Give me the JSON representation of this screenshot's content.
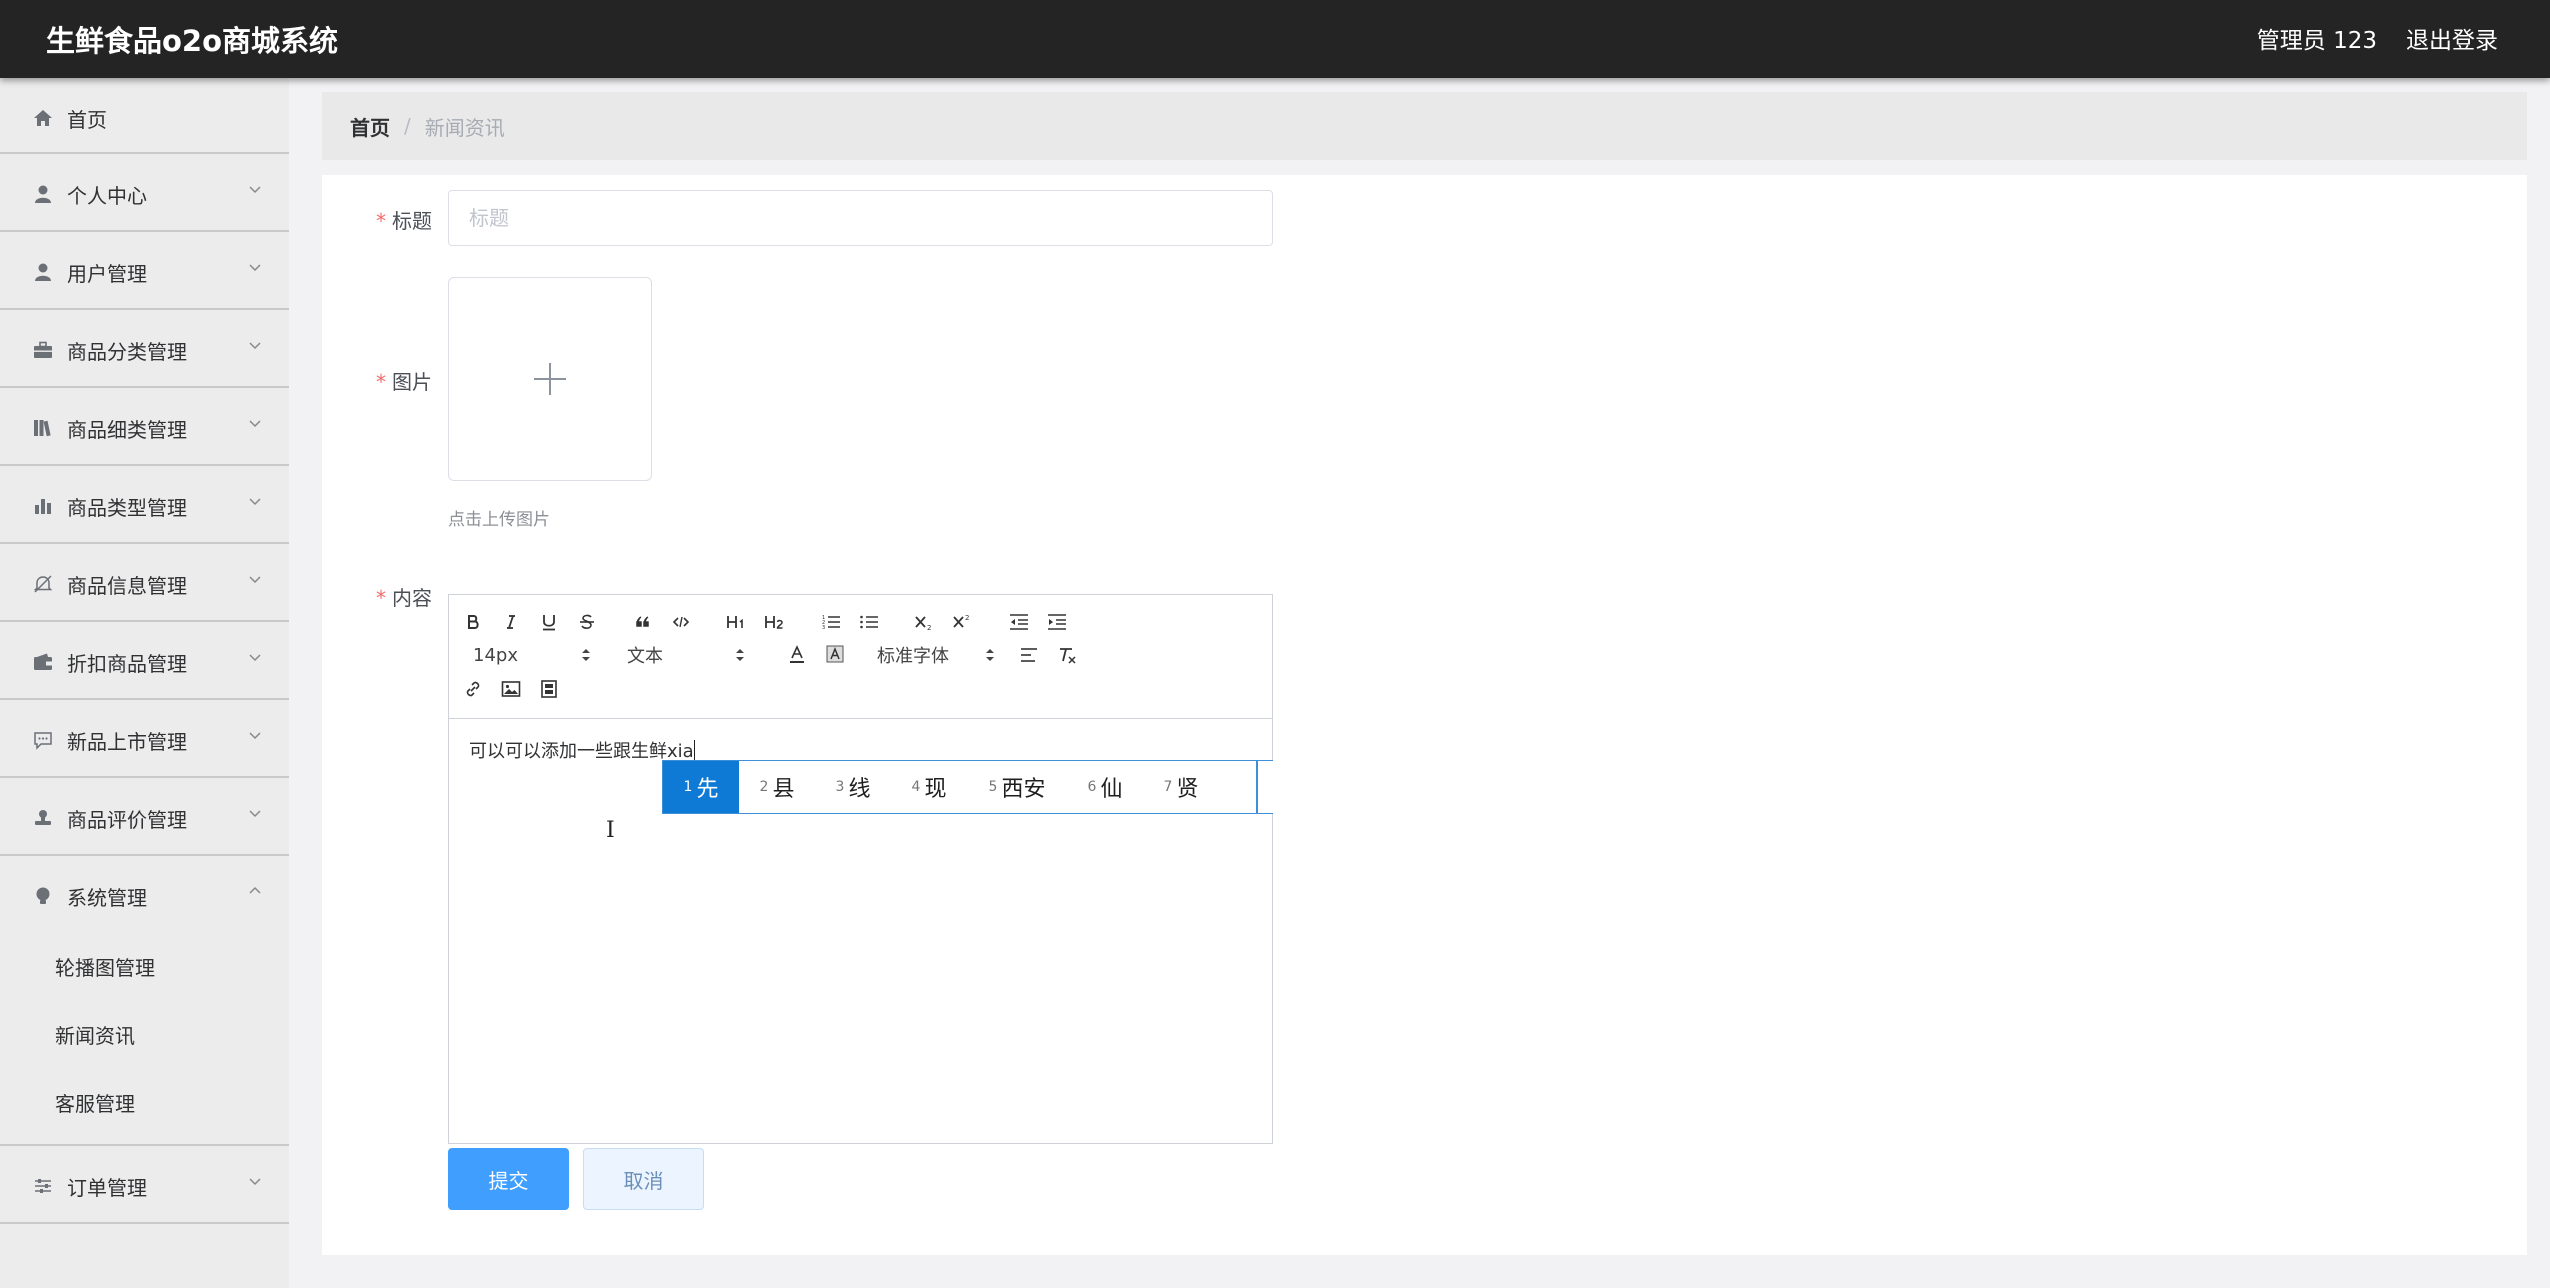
{
  "header": {
    "app_title": "生鲜食品o2o商城系统",
    "user_label": "管理员 123",
    "logout_label": "退出登录"
  },
  "sidebar": {
    "items": [
      {
        "label": "首页",
        "icon": "home-icon"
      },
      {
        "label": "个人中心",
        "icon": "user-icon"
      },
      {
        "label": "用户管理",
        "icon": "user-icon"
      },
      {
        "label": "商品分类管理",
        "icon": "briefcase-icon"
      },
      {
        "label": "商品细类管理",
        "icon": "books-icon"
      },
      {
        "label": "商品类型管理",
        "icon": "bar-chart-icon"
      },
      {
        "label": "商品信息管理",
        "icon": "bell-off-icon"
      },
      {
        "label": "折扣商品管理",
        "icon": "wallet-icon"
      },
      {
        "label": "新品上市管理",
        "icon": "chat-icon"
      },
      {
        "label": "商品评价管理",
        "icon": "stamp-icon"
      },
      {
        "label": "系统管理",
        "icon": "bulb-icon"
      },
      {
        "label": "订单管理",
        "icon": "sliders-icon"
      }
    ],
    "submenu": [
      "轮播图管理",
      "新闻资讯",
      "客服管理"
    ]
  },
  "breadcrumb": {
    "home": "首页",
    "separator": "/",
    "current": "新闻资讯"
  },
  "form": {
    "title_label": "标题",
    "title_placeholder": "标题",
    "image_label": "图片",
    "upload_hint": "点击上传图片",
    "content_label": "内容",
    "required_mark": "*"
  },
  "editor": {
    "font_size": "14px",
    "header_select": "文本",
    "font_family": "标准字体",
    "content_text": "可以可以添加一些跟生鲜xia"
  },
  "ime": {
    "candidates": [
      {
        "num": "1",
        "text": "先"
      },
      {
        "num": "2",
        "text": "县"
      },
      {
        "num": "3",
        "text": "线"
      },
      {
        "num": "4",
        "text": "现"
      },
      {
        "num": "5",
        "text": "西安"
      },
      {
        "num": "6",
        "text": "仙"
      },
      {
        "num": "7",
        "text": "贤"
      }
    ]
  },
  "buttons": {
    "submit": "提交",
    "cancel": "取消"
  },
  "colors": {
    "topbar": "#242424",
    "primary": "#409eff",
    "ime_highlight": "#0e7ad6",
    "required": "#f56c6c"
  }
}
